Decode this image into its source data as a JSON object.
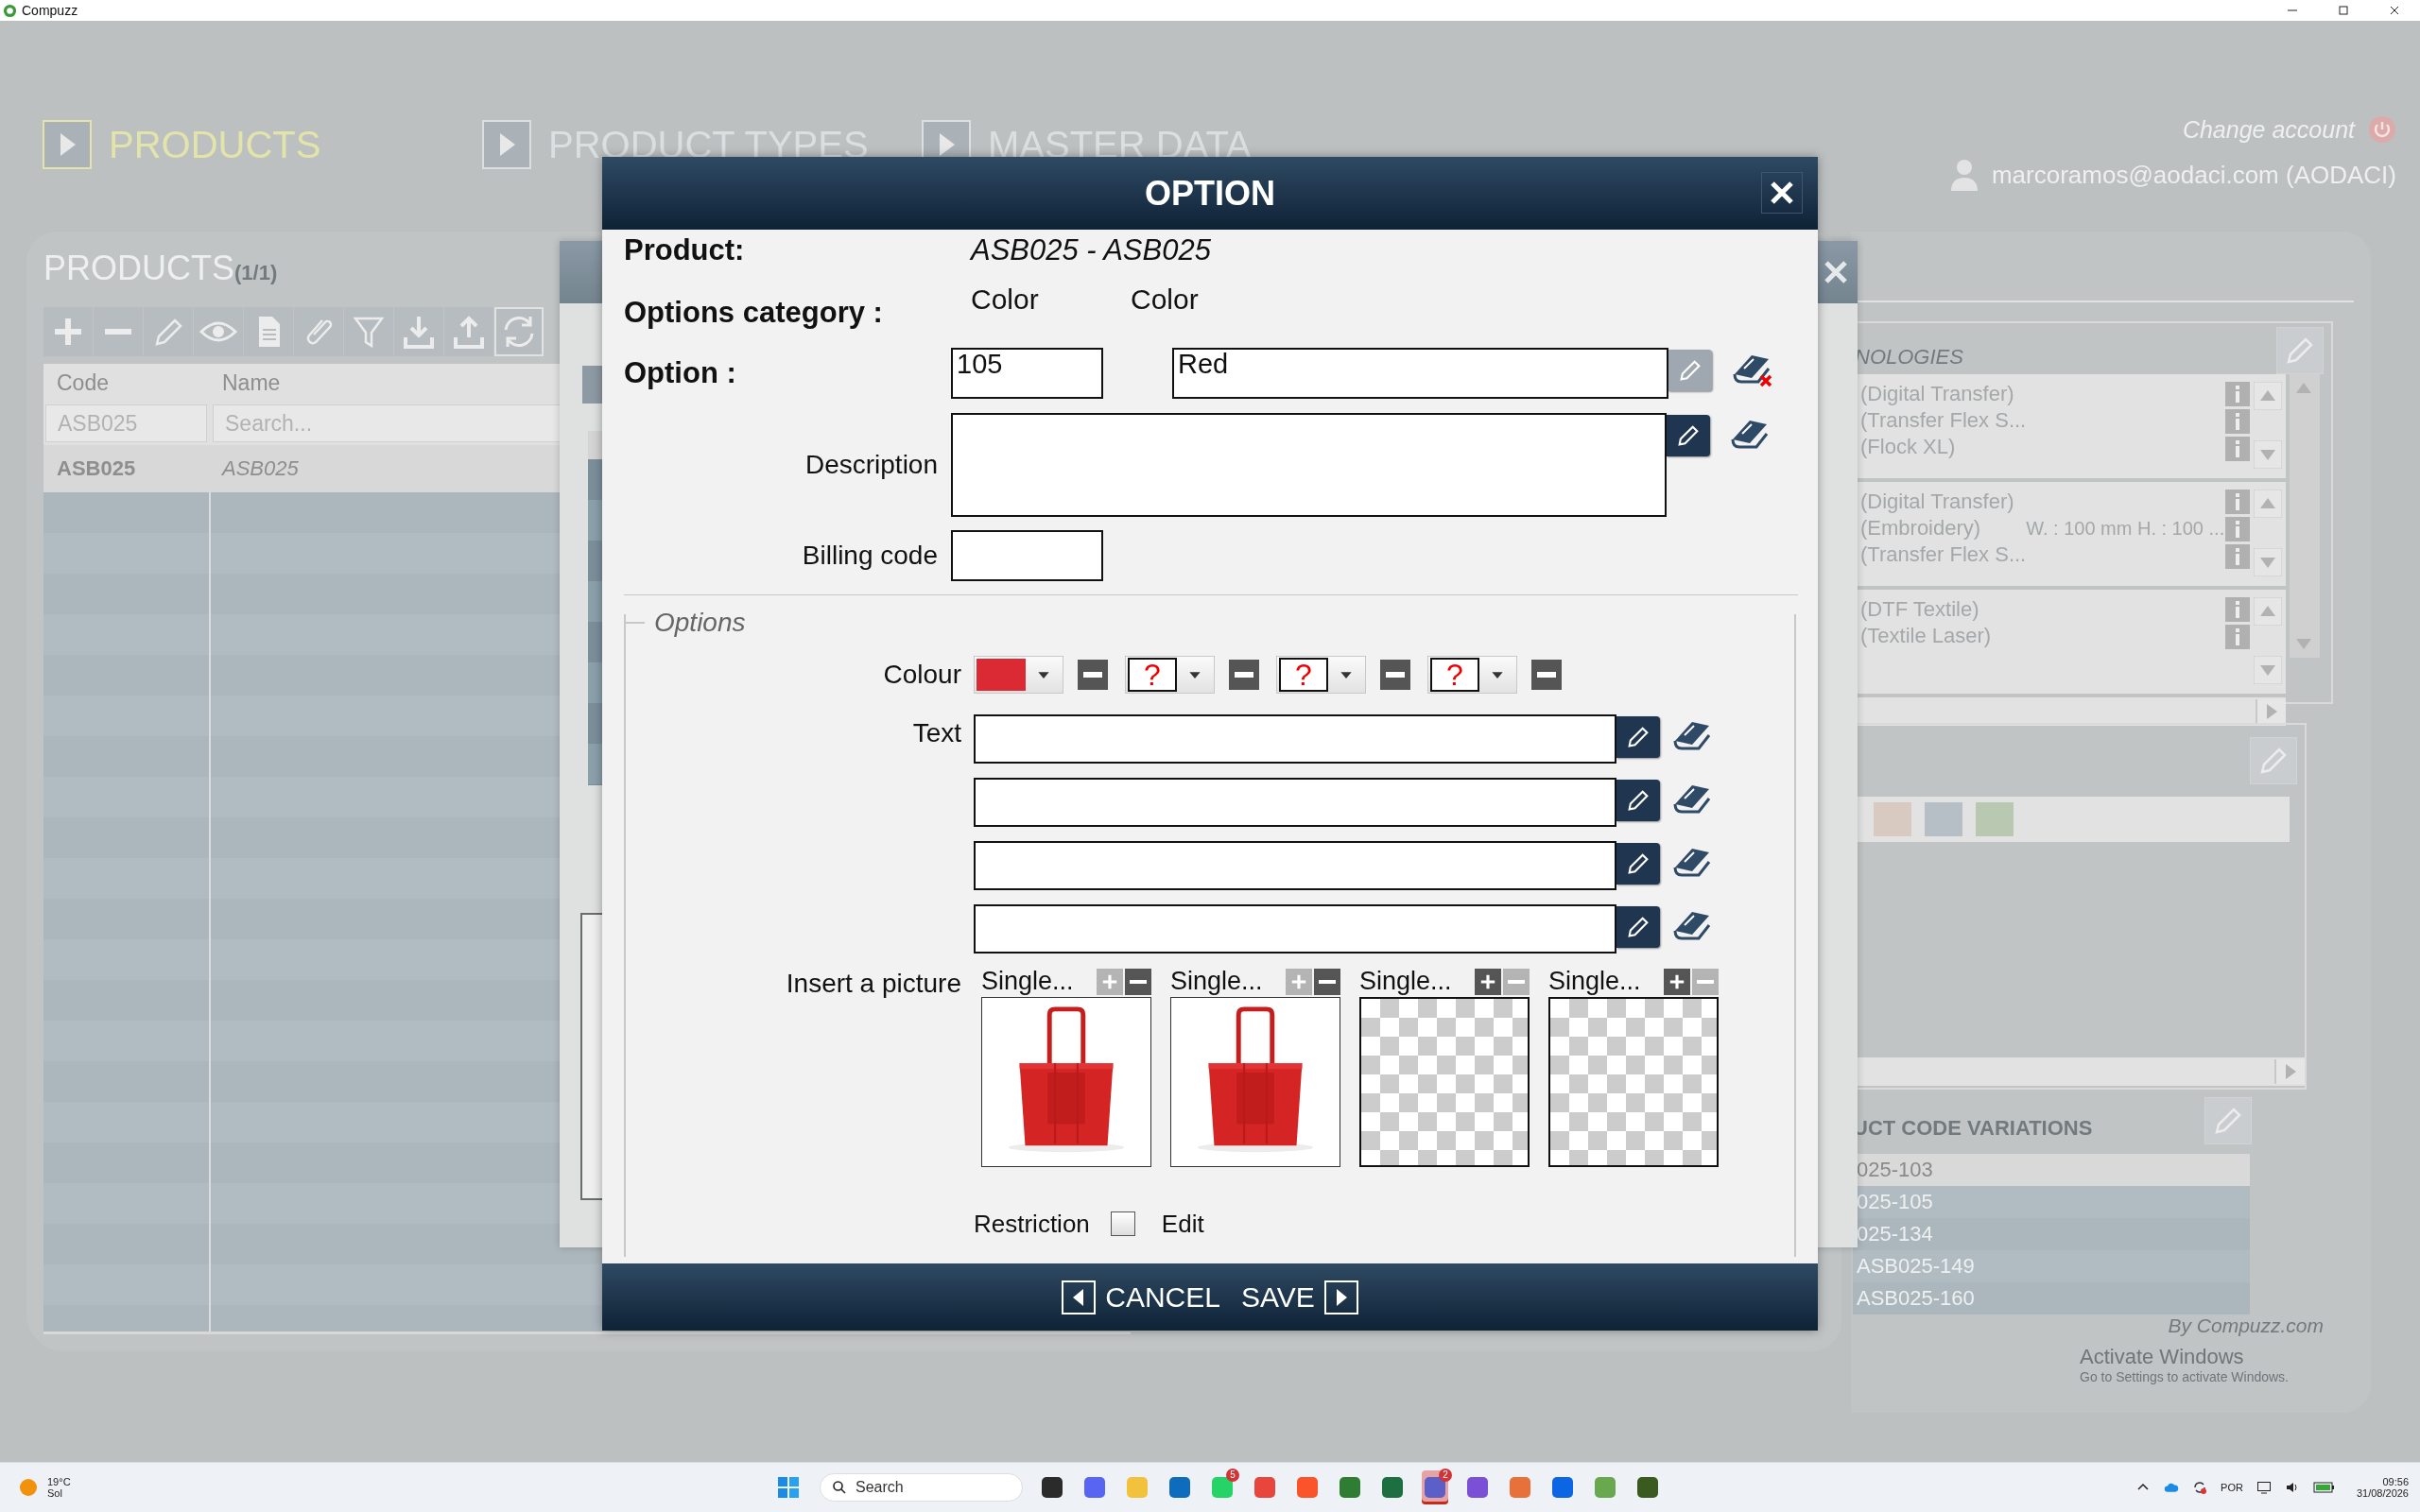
{
  "window": {
    "title": "Compuzz"
  },
  "nav": [
    {
      "label": "PRODUCTS",
      "selected": true
    },
    {
      "label": "PRODUCT TYPES",
      "selected": false
    },
    {
      "label": "MASTER DATA",
      "selected": false
    }
  ],
  "account": {
    "change_label": "Change account",
    "user": "marcoramos@aodaci.com (AODACI)"
  },
  "products": {
    "title": "PRODUCTS",
    "count": "(1/1)",
    "columns": [
      "Code",
      "Name"
    ],
    "filter_value": "ASB025",
    "filter_placeholder": "Search...",
    "rows": [
      {
        "code": "ASB025",
        "name": "ASB025",
        "selected": true
      }
    ]
  },
  "technologies": {
    "title": "NOLOGIES",
    "groups": [
      {
        "lines": [
          {
            "text": "(Digital Transfer)"
          },
          {
            "text": "(Transfer Flex S..."
          },
          {
            "text": "(Flock XL)"
          }
        ]
      },
      {
        "lines": [
          {
            "text": "(Digital Transfer)"
          },
          {
            "text": "(Embroidery)",
            "detail": "W. : 100 mm H. : 100 ..."
          },
          {
            "text": "(Transfer Flex S..."
          }
        ]
      },
      {
        "lines": [
          {
            "text": "(DTF Textile)"
          },
          {
            "text": "(Textile Laser)"
          }
        ]
      }
    ]
  },
  "swatches": [
    {
      "color": "#d8cac1"
    },
    {
      "color": "#b6bfc6"
    },
    {
      "color": "#b8c8b1"
    }
  ],
  "code_variations": {
    "title": "UCT CODE VARIATIONS",
    "items": [
      {
        "text": "025-103",
        "selected": true
      },
      {
        "text": "025-105",
        "selected": false
      },
      {
        "text": "025-134",
        "selected": false
      },
      {
        "text": "ASB025-149",
        "selected": false
      },
      {
        "text": "ASB025-160",
        "selected": false
      }
    ]
  },
  "credit": "By Compuzz.com",
  "activation": {
    "title": "Activate Windows",
    "hint": "Go to Settings to activate Windows."
  },
  "dialog": {
    "title": "OPTION",
    "product_label": "Product:",
    "product_value": "ASB025 - ASB025",
    "category_label": "Options category :",
    "category_values": [
      "Color",
      "Color"
    ],
    "option_label": "Option :",
    "option_code": "105",
    "option_name": "Red",
    "option_edit_disabled": true,
    "description_label": "Description",
    "billing_label": "Billing code",
    "options_legend": "Options",
    "colour_label": "Colour",
    "colours": [
      {
        "kind": "swatch",
        "color": "#dc2a35"
      },
      {
        "kind": "unknown",
        "symbol": "?"
      },
      {
        "kind": "unknown",
        "symbol": "?"
      },
      {
        "kind": "unknown",
        "symbol": "?"
      }
    ],
    "text_label": "Text",
    "text_fields": [
      {
        "kind": "text"
      },
      {
        "kind": "text"
      },
      {
        "kind": "text"
      },
      {
        "kind": "text"
      }
    ],
    "picture_label": "Insert a picture",
    "pictures": [
      {
        "caption": "Single...",
        "filled": true
      },
      {
        "caption": "Single...",
        "filled": true
      },
      {
        "caption": "Single...",
        "filled": false
      },
      {
        "caption": "Single...",
        "filled": false
      }
    ],
    "restriction_label": "Restriction",
    "restriction_checked": false,
    "edit_label": "Edit",
    "cancel": "CANCEL",
    "save": "SAVE"
  },
  "taskbar": {
    "temperature": "19°C",
    "condition": "Sol",
    "search": "Search",
    "apps": [
      {
        "color": "#2b2b2b",
        "selected": false
      },
      {
        "color": "#5865f2",
        "selected": false
      },
      {
        "color": "#f2c23c",
        "selected": false
      },
      {
        "color": "#0f6cbd",
        "selected": false
      },
      {
        "color": "#25d366",
        "badge": "5",
        "selected": false
      },
      {
        "color": "#e8453c",
        "selected": false
      },
      {
        "color": "#fb542b",
        "selected": false
      },
      {
        "color": "#2e7d32",
        "selected": false
      },
      {
        "color": "#1d6f42",
        "selected": false
      },
      {
        "color": "#5b5fc7",
        "badge": "2",
        "selected": true
      },
      {
        "color": "#7b4fd6",
        "selected": false
      },
      {
        "color": "#e8703a",
        "selected": false
      },
      {
        "color": "#0c66e4",
        "selected": false
      },
      {
        "color": "#6aa84f",
        "selected": false
      },
      {
        "color": "#3a5a20",
        "selected": false
      }
    ],
    "language": "POR",
    "time": "09:56",
    "date": "31/08/2026"
  }
}
